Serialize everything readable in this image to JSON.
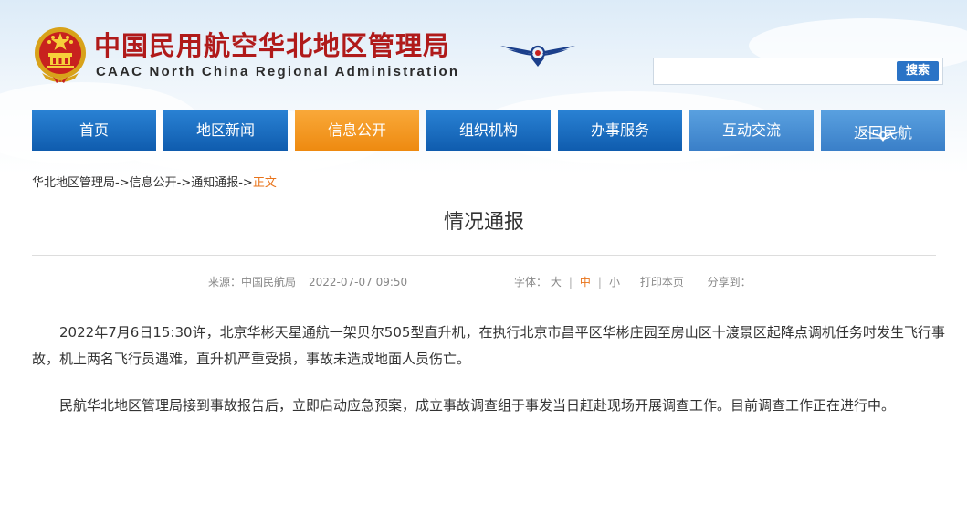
{
  "header": {
    "title_cn": "中国民用航空华北地区管理局",
    "title_en": "CAAC North China Regional Administration",
    "emblem_icon": "national-emblem-icon",
    "logo_icon": "caac-wings-logo-icon"
  },
  "search": {
    "placeholder": "",
    "value": "",
    "button_label": "搜索"
  },
  "nav": {
    "items": [
      {
        "label": "首页"
      },
      {
        "label": "地区新闻"
      },
      {
        "label": "信息公开",
        "active": true
      },
      {
        "label": "组织机构"
      },
      {
        "label": "办事服务"
      },
      {
        "label": "互动交流"
      },
      {
        "label": "返回民航",
        "icon": "caac-wings-icon"
      }
    ]
  },
  "breadcrumb": {
    "items": [
      "华北地区管理局",
      "信息公开",
      "通知通报",
      "正文"
    ],
    "separator": "->"
  },
  "article": {
    "title": "情况通报",
    "meta": {
      "source": "来源：中国民航局",
      "date": "2022-07-07 09:50",
      "font_label": "字体：",
      "font_large": "大",
      "font_medium": "中",
      "font_small": "小",
      "print_label": "打印本页",
      "share_label": "分享到："
    },
    "paragraphs": [
      "2022年7月6日15:30许，北京华彬天星通航一架贝尔505型直升机，在执行北京市昌平区华彬庄园至房山区十渡景区起降点调机任务时发生飞行事故，机上两名飞行员遇难，直升机严重受损，事故未造成地面人员伤亡。",
      "民航华北地区管理局接到事故报告后，立即启动应急预案，成立事故调查组于事发当日赶赴现场开展调查工作。目前调查工作正在进行中。"
    ]
  },
  "colors": {
    "nav_blue": "#1a6bc0",
    "nav_active_orange": "#f39a1e",
    "title_red": "#b01a1a",
    "breadcrumb_current": "#e8731a",
    "search_button": "#2a73c6"
  }
}
